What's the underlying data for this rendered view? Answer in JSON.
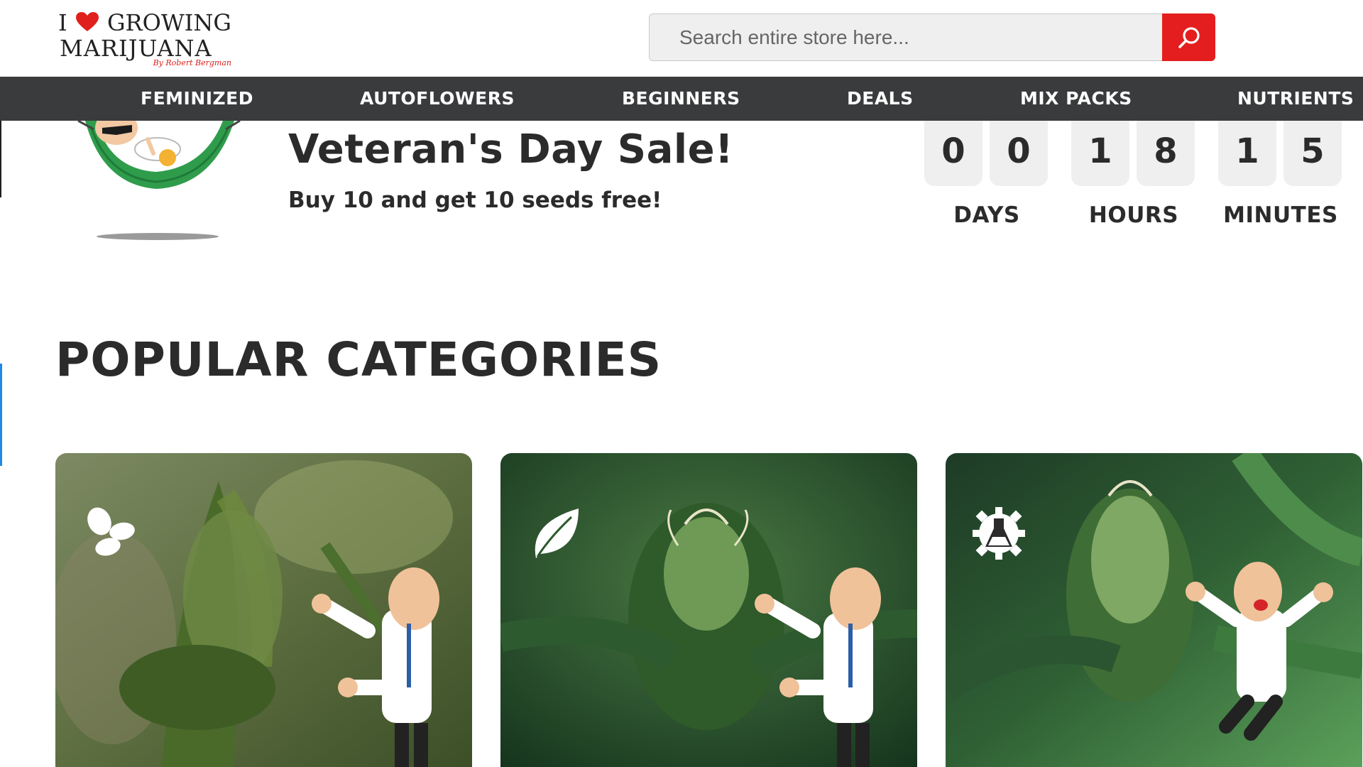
{
  "logo": {
    "line1_prefix": "I",
    "line1_suffix": "GROWING",
    "line2": "MARIJUANA",
    "byline": "By Robert Bergman"
  },
  "search": {
    "placeholder": "Search entire store here...",
    "value": ""
  },
  "nav": {
    "items": [
      "FEMINIZED",
      "AUTOFLOWERS",
      "BEGINNERS",
      "DEALS",
      "MIX PACKS",
      "NUTRIENTS"
    ]
  },
  "promo": {
    "title": "Veteran's Day Sale!",
    "subtitle": "Buy 10 and get 10 seeds free!"
  },
  "countdown": {
    "days": [
      "0",
      "0"
    ],
    "hours": [
      "1",
      "8"
    ],
    "minutes": [
      "1",
      "5"
    ],
    "labels": {
      "days": "DAYS",
      "hours": "HOURS",
      "minutes": "MINUTES"
    }
  },
  "categories": {
    "title": "POPULAR CATEGORIES",
    "cards": [
      {
        "icon": "butterfly-icon"
      },
      {
        "icon": "leaf-icon"
      },
      {
        "icon": "gear-flask-icon"
      }
    ]
  },
  "colors": {
    "accent_red": "#e41e1e",
    "nav_bg": "#3a3b3d",
    "text_dark": "#2b2b2b",
    "countdown_box": "#efefef"
  }
}
